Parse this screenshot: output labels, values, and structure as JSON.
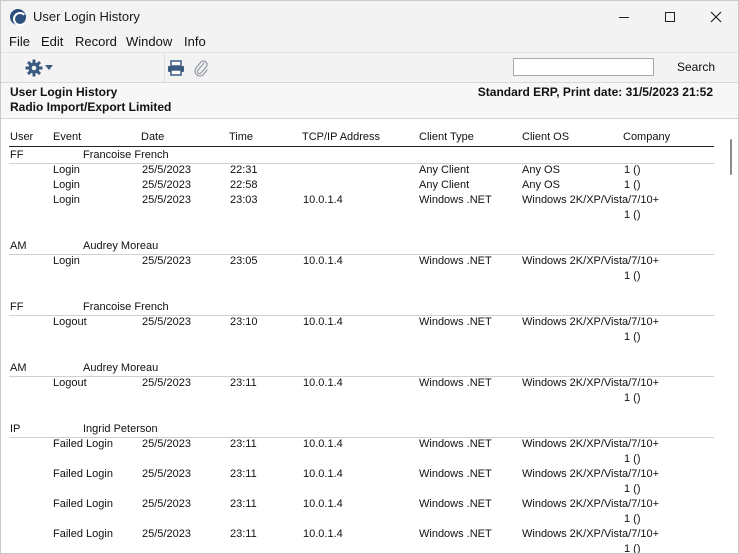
{
  "window": {
    "title": "User Login History"
  },
  "menu": [
    "File",
    "Edit",
    "Record",
    "Window",
    "Info"
  ],
  "toolbar": {
    "search_value": "",
    "search_label": "Search"
  },
  "report": {
    "title": "User Login History",
    "company": "Radio Import/Export Limited",
    "print_info": "Standard ERP, Print date: 31/5/2023 21:52"
  },
  "columns": [
    "User",
    "Event",
    "Date",
    "Time",
    "TCP/IP Address",
    "Client Type",
    "Client OS",
    "Company"
  ],
  "groups": [
    {
      "code": "FF",
      "name": "Francoise French",
      "events": [
        {
          "event": "Login",
          "date": "25/5/2023",
          "time": "22:31",
          "ip": "",
          "client_type": "Any Client",
          "client_os": "Any OS",
          "company": "1 ()",
          "wrap": false
        },
        {
          "event": "Login",
          "date": "25/5/2023",
          "time": "22:58",
          "ip": "",
          "client_type": "Any Client",
          "client_os": "Any OS",
          "company": "1 ()",
          "wrap": false
        },
        {
          "event": "Login",
          "date": "25/5/2023",
          "time": "23:03",
          "ip": "10.0.1.4",
          "client_type": "Windows .NET",
          "client_os": "Windows 2K/XP/Vista/7/10+",
          "company": "1 ()",
          "wrap": true
        }
      ]
    },
    {
      "code": "AM",
      "name": "Audrey Moreau",
      "events": [
        {
          "event": "Login",
          "date": "25/5/2023",
          "time": "23:05",
          "ip": "10.0.1.4",
          "client_type": "Windows .NET",
          "client_os": "Windows 2K/XP/Vista/7/10+",
          "company": "1 ()",
          "wrap": true
        }
      ]
    },
    {
      "code": "FF",
      "name": "Francoise French",
      "events": [
        {
          "event": "Logout",
          "date": "25/5/2023",
          "time": "23:10",
          "ip": "10.0.1.4",
          "client_type": "Windows .NET",
          "client_os": "Windows 2K/XP/Vista/7/10+",
          "company": "1 ()",
          "wrap": true
        }
      ]
    },
    {
      "code": "AM",
      "name": "Audrey Moreau",
      "events": [
        {
          "event": "Logout",
          "date": "25/5/2023",
          "time": "23:11",
          "ip": "10.0.1.4",
          "client_type": "Windows .NET",
          "client_os": "Windows 2K/XP/Vista/7/10+",
          "company": "1 ()",
          "wrap": true
        }
      ]
    },
    {
      "code": "IP",
      "name": "Ingrid Peterson",
      "events": [
        {
          "event": "Failed Login",
          "date": "25/5/2023",
          "time": "23:11",
          "ip": "10.0.1.4",
          "client_type": "Windows .NET",
          "client_os": "Windows 2K/XP/Vista/7/10+",
          "company": "1 ()",
          "wrap": true
        },
        {
          "event": "Failed Login",
          "date": "25/5/2023",
          "time": "23:11",
          "ip": "10.0.1.4",
          "client_type": "Windows .NET",
          "client_os": "Windows 2K/XP/Vista/7/10+",
          "company": "1 ()",
          "wrap": true
        },
        {
          "event": "Failed Login",
          "date": "25/5/2023",
          "time": "23:11",
          "ip": "10.0.1.4",
          "client_type": "Windows .NET",
          "client_os": "Windows 2K/XP/Vista/7/10+",
          "company": "1 ()",
          "wrap": true
        },
        {
          "event": "Failed Login",
          "date": "25/5/2023",
          "time": "23:11",
          "ip": "10.0.1.4",
          "client_type": "Windows .NET",
          "client_os": "Windows 2K/XP/Vista/7/10+",
          "company": "1 ()",
          "wrap": true
        }
      ]
    }
  ]
}
